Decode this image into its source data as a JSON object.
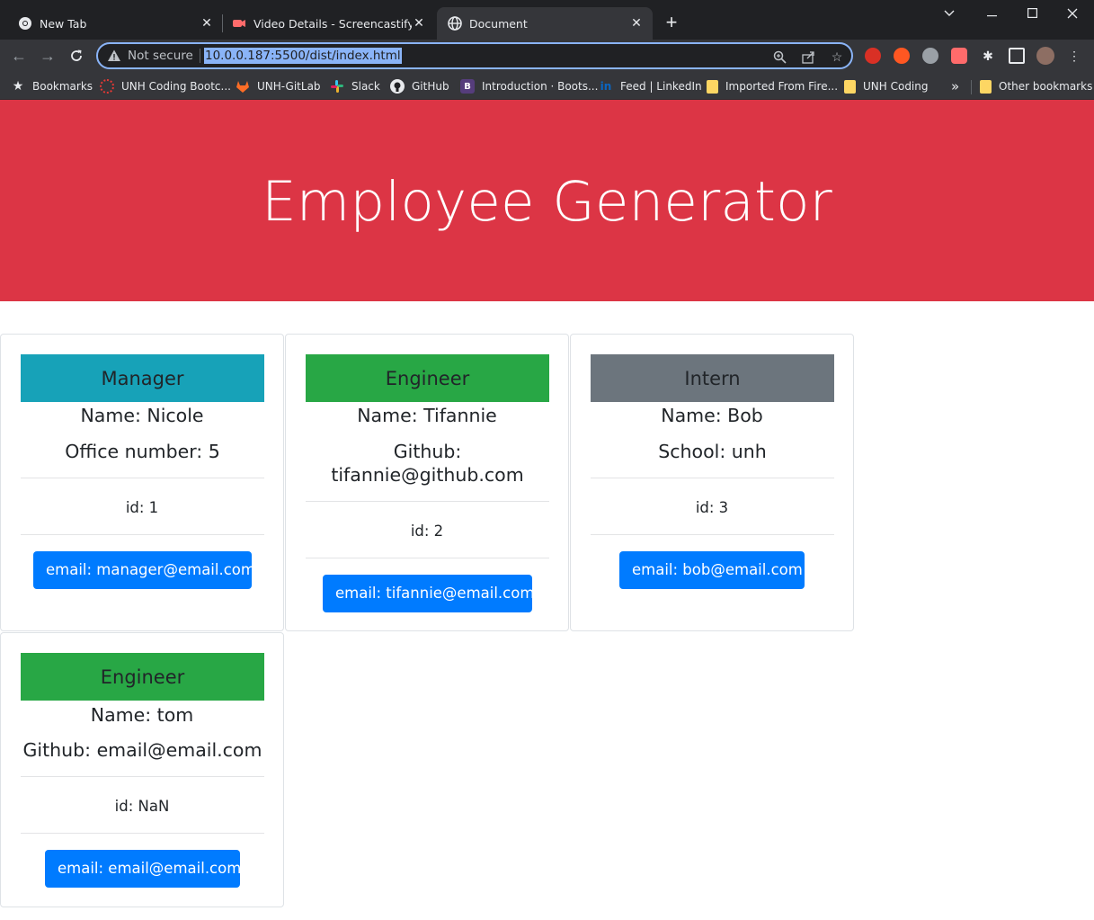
{
  "browser": {
    "tabs": [
      {
        "title": "New Tab",
        "icon": "chrome-icon"
      },
      {
        "title": "Video Details - Screencastify",
        "icon": "screencastify-icon"
      },
      {
        "title": "Document",
        "icon": "globe-icon",
        "active": true
      }
    ],
    "new_tab_symbol": "+",
    "address": {
      "security_label": "Not secure",
      "url": "10.0.0.187:5500/dist/index.html"
    },
    "bookmarks": [
      {
        "label": "Bookmarks",
        "icon": "star-icon"
      },
      {
        "label": "UNH Coding Bootc...",
        "icon": "unh-icon"
      },
      {
        "label": "UNH-GitLab",
        "icon": "gitlab-icon"
      },
      {
        "label": "Slack",
        "icon": "slack-icon"
      },
      {
        "label": "GitHub",
        "icon": "github-icon"
      },
      {
        "label": "Introduction · Boots...",
        "icon": "bootstrap-icon"
      },
      {
        "label": "Feed | LinkedIn",
        "icon": "linkedin-icon"
      },
      {
        "label": "Imported From Fire...",
        "icon": "folder-icon"
      },
      {
        "label": "UNH Coding",
        "icon": "folder-icon"
      },
      {
        "label": "Other bookmarks",
        "icon": "folder-icon"
      }
    ],
    "overflow_symbol": "»"
  },
  "page": {
    "title": "Employee Generator",
    "colors": {
      "header_red": "#dc3545",
      "manager": "#17a2b8",
      "engineer": "#28a745",
      "intern": "#6c757d",
      "button_blue": "#007bff"
    },
    "cards": [
      {
        "role": "Manager",
        "name": "Name: Nicole",
        "detail": "Office number: 5",
        "id": "id: 1",
        "email": "email: manager@email.com"
      },
      {
        "role": "Engineer",
        "name": "Name: Tifannie",
        "detail_line1": "Github:",
        "detail_line2": "tifannie@github.com",
        "id": "id: 2",
        "email": "email: tifannie@email.com"
      },
      {
        "role": "Intern",
        "name": "Name: Bob",
        "detail": "School: unh",
        "id": "id: 3",
        "email": "email: bob@email.com"
      },
      {
        "role": "Engineer",
        "name": "Name: tom",
        "detail": "Github: email@email.com",
        "id": "id: NaN",
        "email": "email: email@email.com"
      }
    ]
  }
}
